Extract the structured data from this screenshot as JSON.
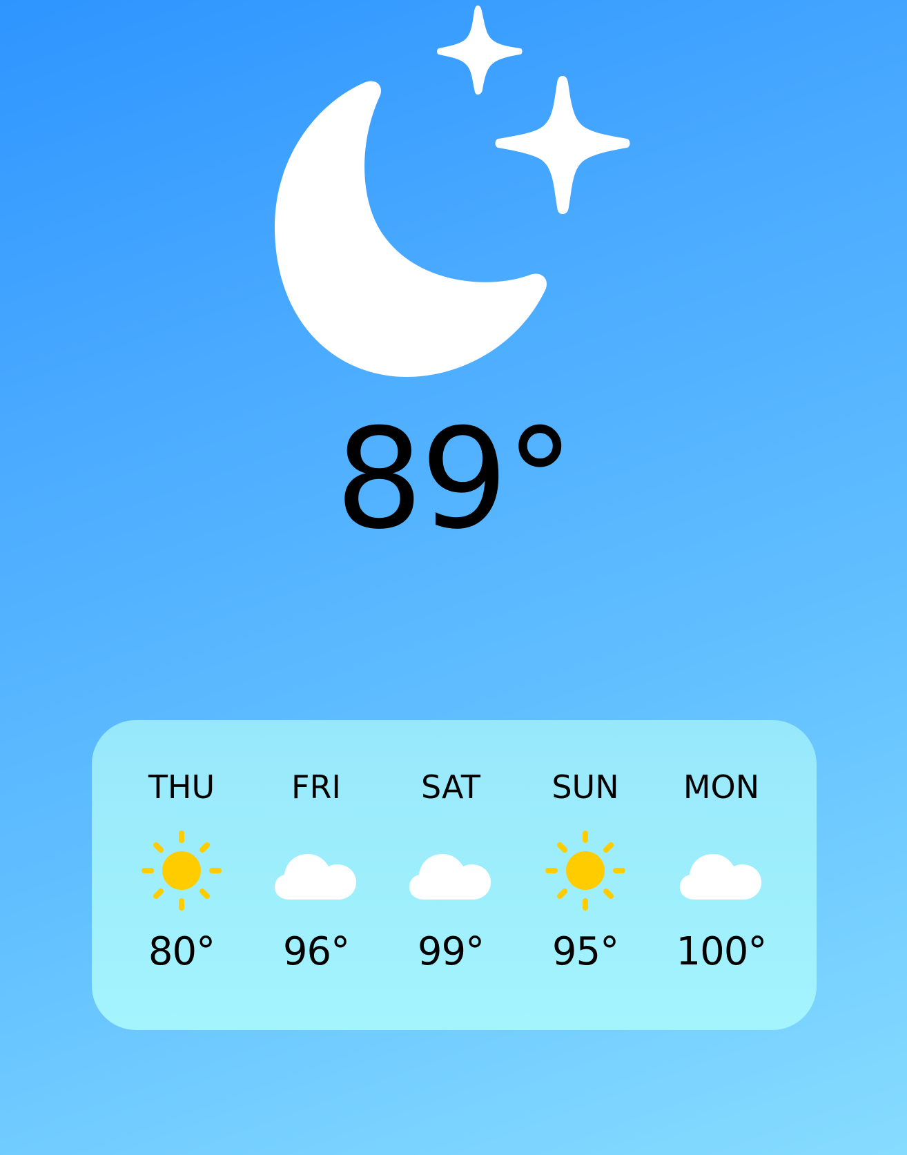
{
  "current": {
    "temperature": "89°",
    "condition_icon": "moon-stars-icon"
  },
  "forecast": [
    {
      "day": "THU",
      "icon": "sun-icon",
      "temp": "80°"
    },
    {
      "day": "FRI",
      "icon": "cloud-icon",
      "temp": "96°"
    },
    {
      "day": "SAT",
      "icon": "cloud-icon",
      "temp": "99°"
    },
    {
      "day": "SUN",
      "icon": "sun-icon",
      "temp": "95°"
    },
    {
      "day": "MON",
      "icon": "cloud-icon",
      "temp": "100°"
    }
  ],
  "colors": {
    "background_top": "#2e95ff",
    "background_bottom": "#86dcff",
    "card": "#a3f4fd",
    "sun": "#ffcc00",
    "cloud": "#ffffff",
    "text": "#000000"
  }
}
